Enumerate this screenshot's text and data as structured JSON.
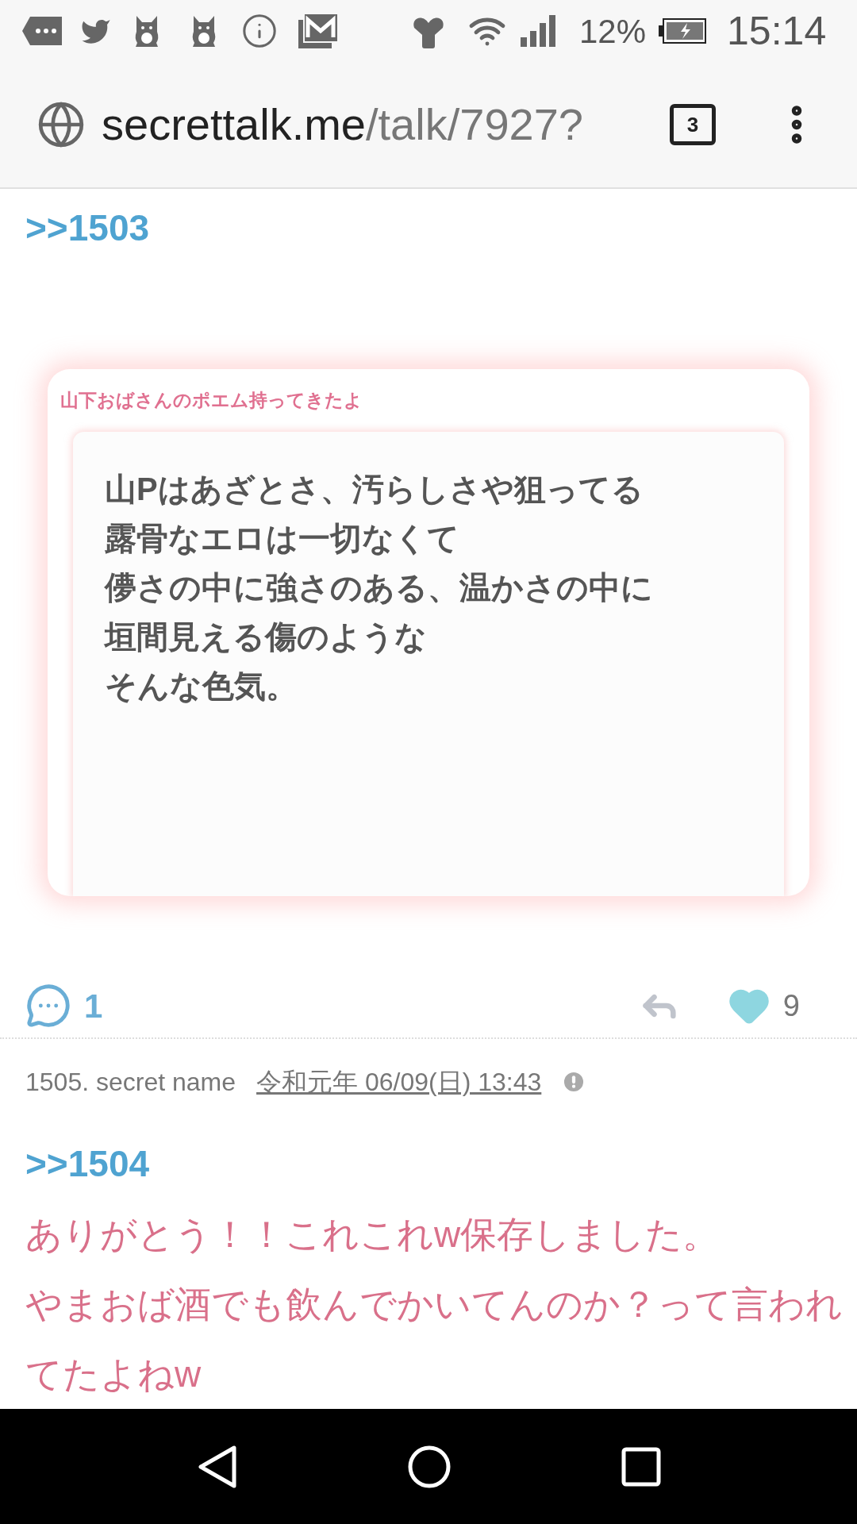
{
  "status_bar": {
    "battery": "12%",
    "time": "15:14"
  },
  "browser": {
    "url_domain": "secrettalk.me",
    "url_path": "/talk/7927?",
    "tab_count": "3"
  },
  "post_top": {
    "reply_to": ">>1503",
    "embedded_image": {
      "caption": "山下おばさんのポエム持ってきたよ",
      "lines": [
        "山Pはあざとさ、汚らしさや狙ってる",
        "露骨なエロは一切なくて",
        "儚さの中に強さのある、温かさの中に",
        "垣間見える傷のような",
        "そんな色気。"
      ]
    },
    "comment_count": "1",
    "like_count": "9"
  },
  "post": {
    "author": "1505. secret name",
    "date": "令和元年 06/09(日) 13:43",
    "reply_to": ">>1504",
    "lines": [
      "ありがとう！！これこれw保存しました。",
      "やまおば酒でも飲んでかいてんのか？って言われてたよねw"
    ]
  }
}
